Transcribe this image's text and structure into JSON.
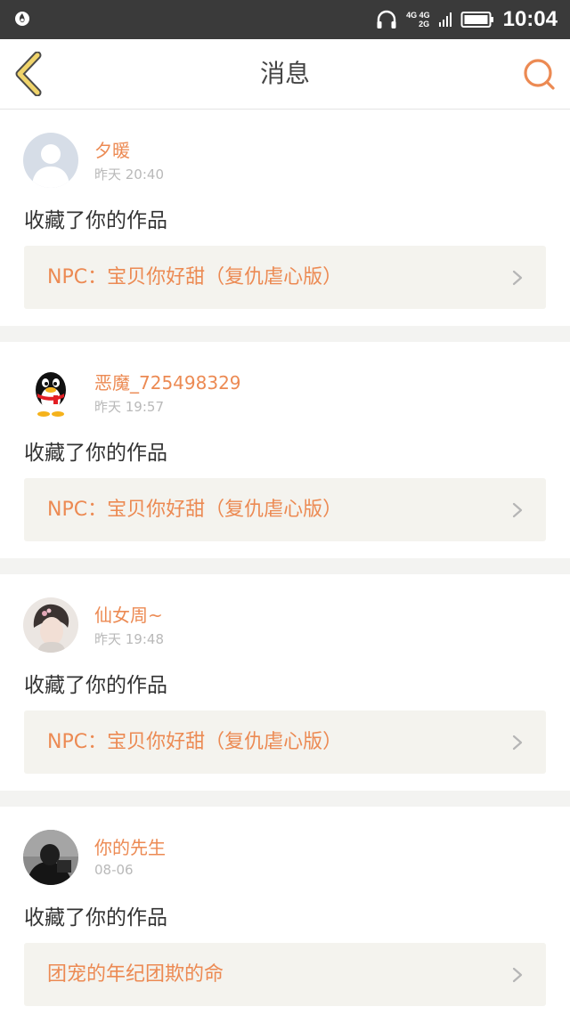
{
  "status_bar": {
    "network_top": "4G 4G",
    "network_bottom": "2G",
    "time": "10:04"
  },
  "header": {
    "title": "消息"
  },
  "messages": [
    {
      "username": "夕暖",
      "time": "昨天 20:40",
      "action": "收藏了你的作品",
      "work_title": "NPC：宝贝你好甜（复仇虐心版）"
    },
    {
      "username": "恶魔_725498329",
      "time": "昨天 19:57",
      "action": "收藏了你的作品",
      "work_title": "NPC：宝贝你好甜（复仇虐心版）"
    },
    {
      "username": "仙女周~",
      "time": "昨天 19:48",
      "action": "收藏了你的作品",
      "work_title": "NPC：宝贝你好甜（复仇虐心版）"
    },
    {
      "username": "你的先生",
      "time": "08-06",
      "action": "收藏了你的作品",
      "work_title": "团宠的年纪团欺的命"
    }
  ],
  "icons": {
    "back": "chevron-left-icon",
    "search": "search-icon",
    "headphones": "headphones-icon",
    "battery": "battery-icon",
    "signal": "signal-icon",
    "item_arrow": "chevron-right-icon"
  },
  "colors": {
    "accent": "#ec8a53",
    "back_arrow": "#f0d46a",
    "status_bar": "#3a3a3a",
    "card_link_bg": "#f4f3ee",
    "divider": "#f3f3f1"
  }
}
